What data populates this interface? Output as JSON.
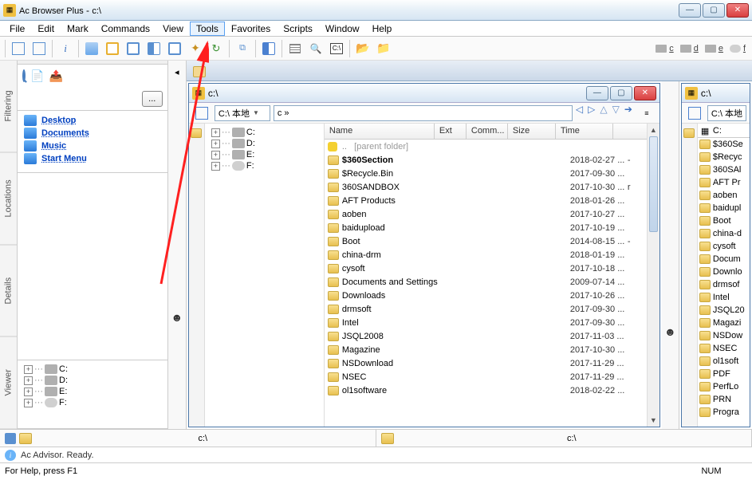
{
  "titlebar": {
    "app": "Ac Browser Plus",
    "path": "c:\\"
  },
  "menu": [
    "File",
    "Edit",
    "Mark",
    "Commands",
    "View",
    "Tools",
    "Favorites",
    "Scripts",
    "Window",
    "Help"
  ],
  "menu_active_index": 5,
  "drive_chips": [
    "c",
    "d",
    "e",
    "f"
  ],
  "sidebar_tabs": [
    "Filtering",
    "Locations",
    "Details",
    "Viewer"
  ],
  "dots_button": "...",
  "locations": [
    "Desktop",
    "Documents",
    "Music",
    "Start Menu"
  ],
  "left_drive_tree": [
    "C:",
    "D:",
    "E:",
    "F:"
  ],
  "left_pane": {
    "title": "c:\\",
    "combo1": "C:\\ 本地",
    "combo2": "c »",
    "tree_drives": [
      "C:",
      "D:",
      "E:",
      "F:"
    ],
    "columns": {
      "name": "Name",
      "ext": "Ext",
      "comm": "Comm...",
      "size": "Size",
      "time": "Time"
    },
    "parent_row": {
      "name": "..",
      "hint": "[parent folder]"
    },
    "rows": [
      {
        "name": "$360Section",
        "time": "2018-02-27 ...",
        "extra": "-",
        "bold": true
      },
      {
        "name": "$Recycle.Bin",
        "time": "2017-09-30 ...",
        "extra": ""
      },
      {
        "name": "360SANDBOX",
        "time": "2017-10-30 ...",
        "extra": "r"
      },
      {
        "name": "AFT Products",
        "time": "2018-01-26 ...",
        "extra": ""
      },
      {
        "name": "aoben",
        "time": "2017-10-27 ...",
        "extra": ""
      },
      {
        "name": "baidupload",
        "time": "2017-10-19 ...",
        "extra": ""
      },
      {
        "name": "Boot",
        "time": "2014-08-15 ...",
        "extra": "-"
      },
      {
        "name": "china-drm",
        "time": "2018-01-19 ...",
        "extra": ""
      },
      {
        "name": "cysoft",
        "time": "2017-10-18 ...",
        "extra": ""
      },
      {
        "name": "Documents and Settings",
        "time": "2009-07-14 ...",
        "extra": ""
      },
      {
        "name": "Downloads",
        "time": "2017-10-26 ...",
        "extra": ""
      },
      {
        "name": "drmsoft",
        "time": "2017-09-30 ...",
        "extra": ""
      },
      {
        "name": "Intel",
        "time": "2017-09-30 ...",
        "extra": ""
      },
      {
        "name": "JSQL2008",
        "time": "2017-11-03 ...",
        "extra": ""
      },
      {
        "name": "Magazine",
        "time": "2017-10-30 ...",
        "extra": ""
      },
      {
        "name": "NSDownload",
        "time": "2017-11-29 ...",
        "extra": ""
      },
      {
        "name": "NSEC",
        "time": "2017-11-29 ...",
        "extra": ""
      },
      {
        "name": "ol1software",
        "time": "2018-02-22 ...",
        "extra": ""
      }
    ]
  },
  "right_pane": {
    "title": "c:\\",
    "combo1": "C:\\ 本地",
    "combo_head": "C:",
    "rows": [
      "$360Se",
      "$Recyc",
      "360SAl",
      "AFT Pr",
      "aoben",
      "baidupl",
      "Boot",
      "china-d",
      "cysoft",
      "Docum",
      "Downlo",
      "drmsof",
      "Intel",
      "JSQL20",
      "Magazi",
      "NSDow",
      "NSEC",
      "ol1soft",
      "PDF",
      "PerfLo",
      "PRN",
      "Progra"
    ]
  },
  "status": {
    "path_left": "c:\\",
    "path_right": "c:\\",
    "advisor": "Ac Advisor. Ready.",
    "help": "For Help, press F1",
    "num": "NUM"
  }
}
